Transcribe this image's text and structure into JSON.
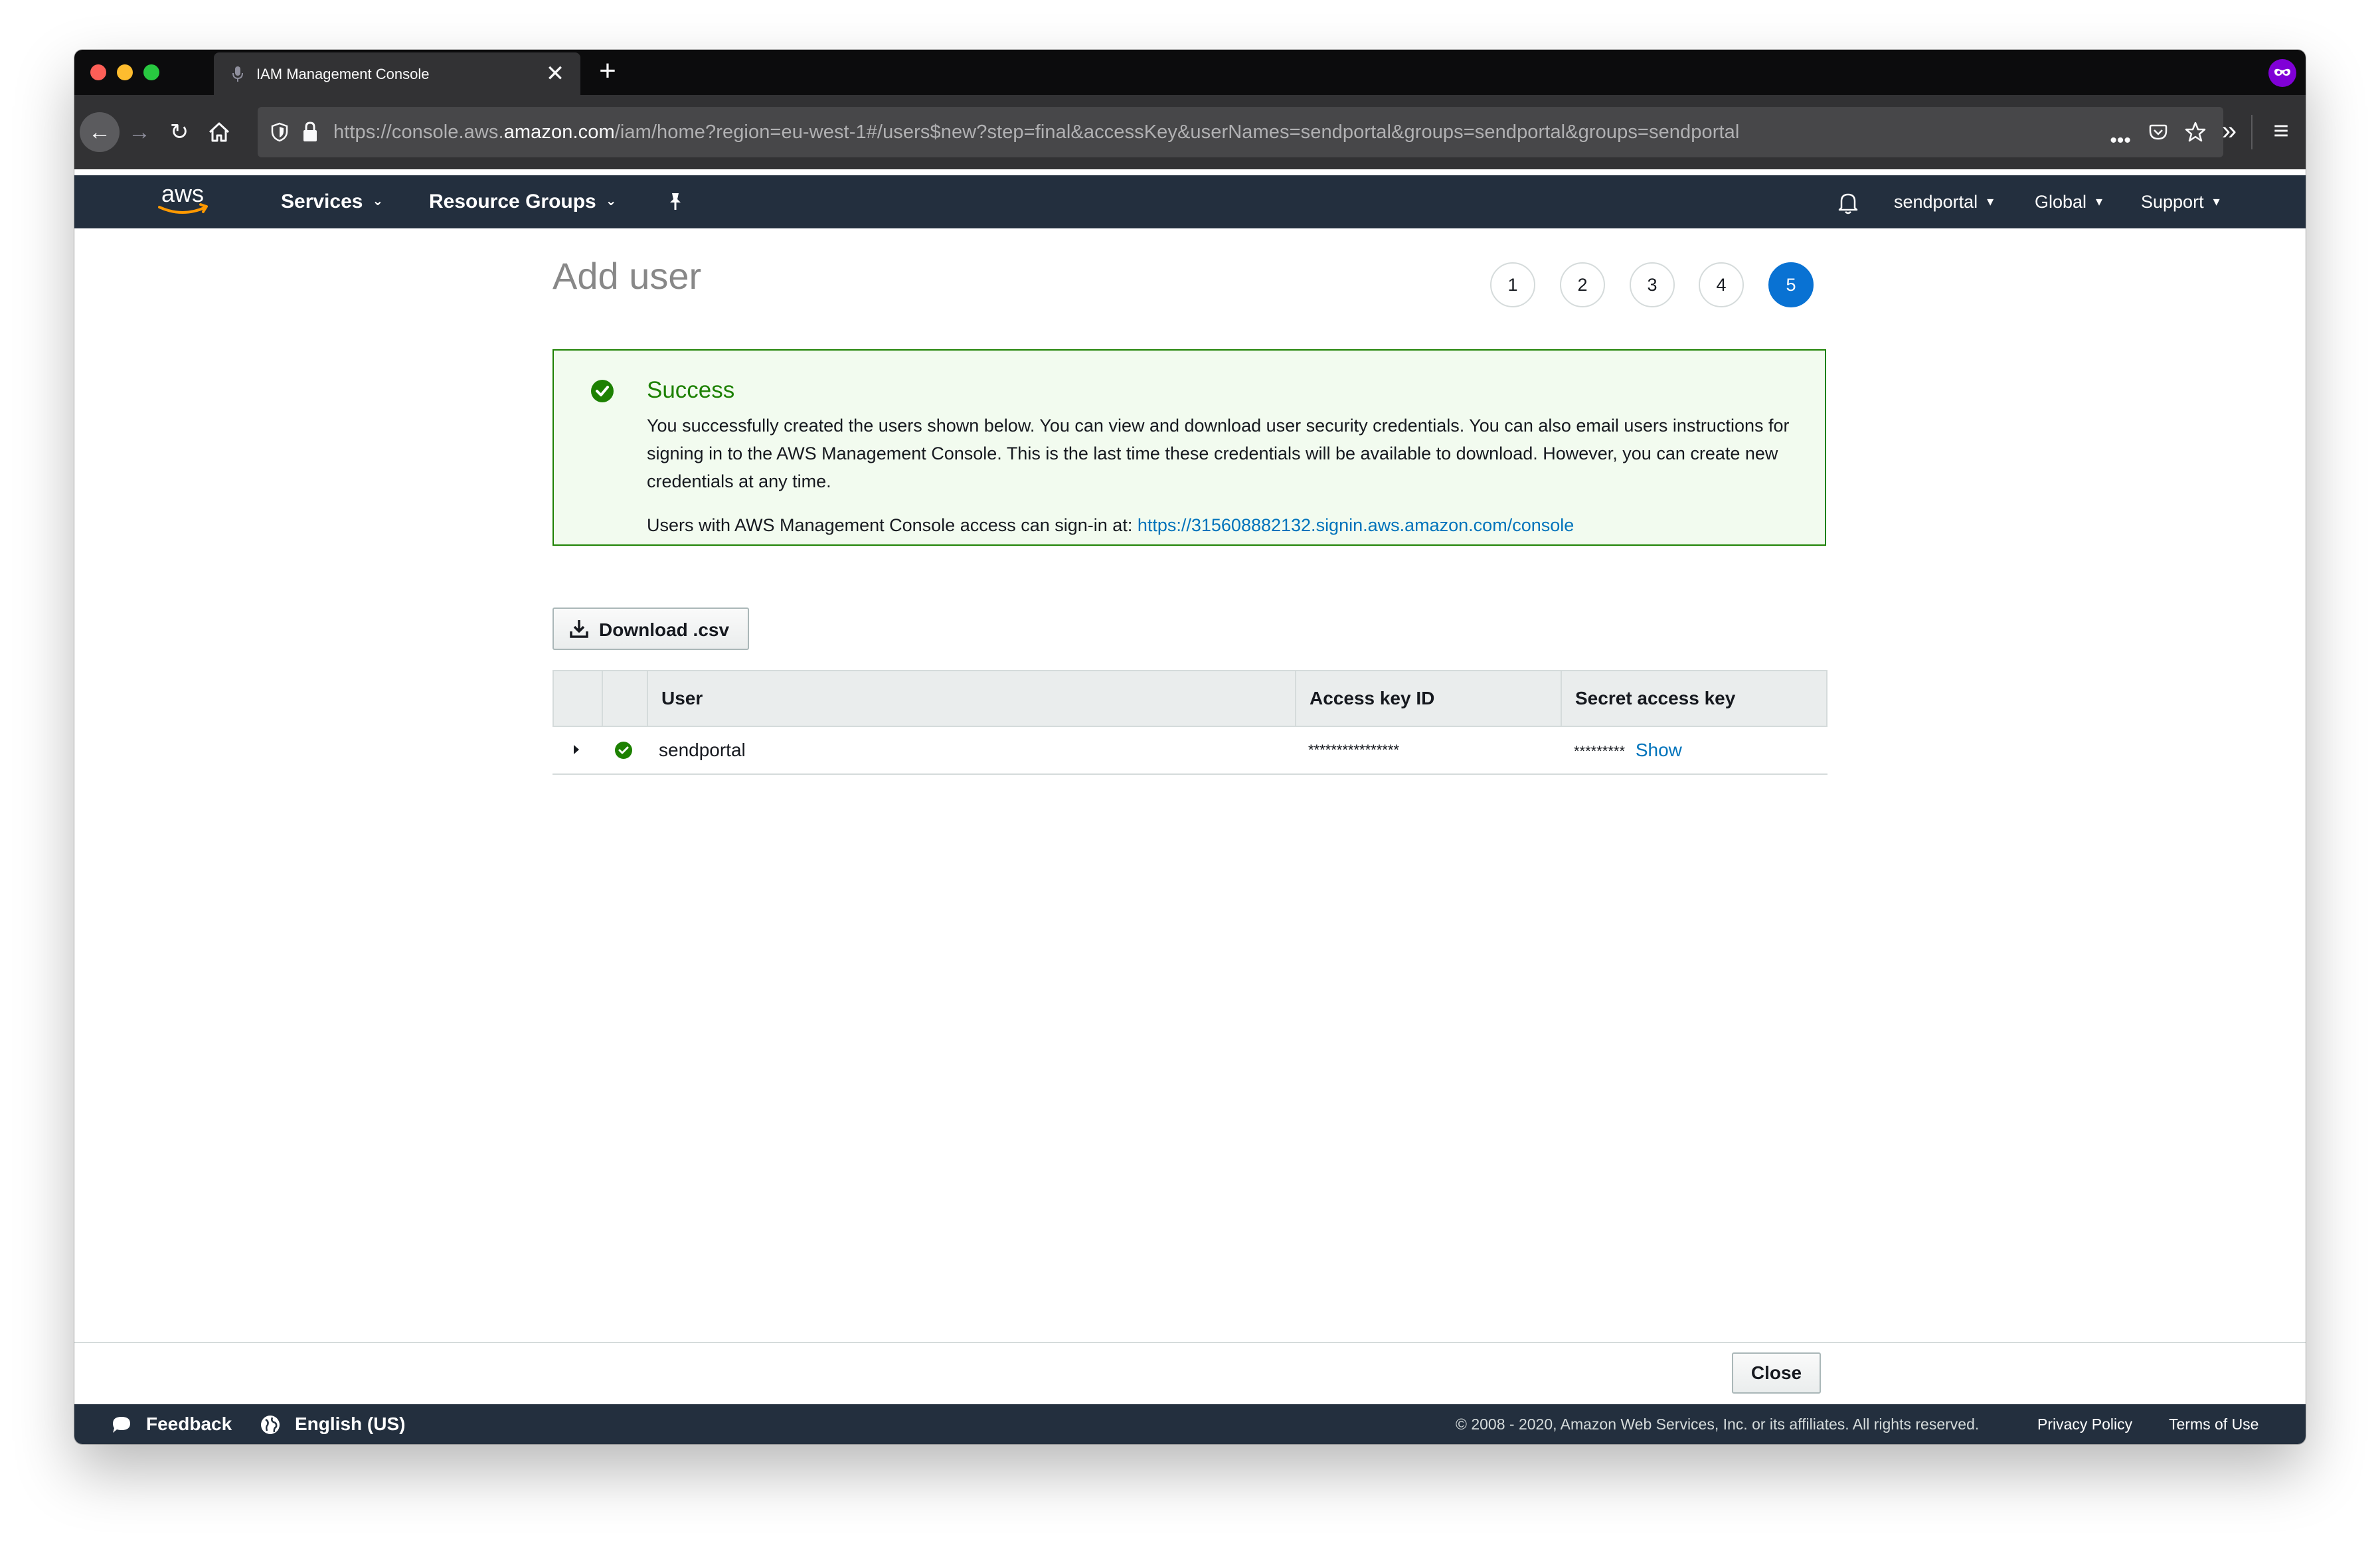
{
  "browser": {
    "tab_title": "IAM Management Console",
    "tab_close": "✕",
    "new_tab": "+",
    "url_prefix": "https://console.aws.",
    "url_domain": "amazon.com",
    "url_path": "/iam/home?region=eu-west-1#/users$new?step=final&accessKey&userNames=sendportal&groups=sendportal&groups=sendportal",
    "url_more": "•••",
    "back": "←",
    "forward": "→",
    "reload": "↻",
    "overflow": "»",
    "menu": "≡"
  },
  "aws_header": {
    "services": "Services",
    "resource_groups": "Resource Groups",
    "account": "sendportal",
    "region": "Global",
    "support": "Support"
  },
  "page": {
    "title": "Add user",
    "steps": [
      "1",
      "2",
      "3",
      "4",
      "5"
    ],
    "active_step": 5
  },
  "alert": {
    "title": "Success",
    "body": "You successfully created the users shown below. You can view and download user security credentials. You can also email users instructions for signing in to the AWS Management Console. This is the last time these credentials will be available to download. However, you can create new credentials at any time.",
    "signin_prefix": "Users with AWS Management Console access can sign-in at: ",
    "signin_url": "https://315608882132.signin.aws.amazon.com/console",
    "status_color": "#1d8102"
  },
  "download_button": "Download .csv",
  "table": {
    "headers": [
      "User",
      "Access key ID",
      "Secret access key"
    ],
    "rows": [
      {
        "user": "sendportal",
        "access_key_id": "****************",
        "secret_access_key": "*********",
        "show_link": "Show"
      }
    ]
  },
  "close_button": "Close",
  "footer": {
    "feedback": "Feedback",
    "language": "English (US)",
    "copyright": "© 2008 - 2020, Amazon Web Services, Inc. or its affiliates. All rights reserved.",
    "privacy": "Privacy Policy",
    "terms": "Terms of Use"
  },
  "colors": {
    "aws_nav": "#232f3e",
    "accent_blue": "#0972d3",
    "link_blue": "#0073bb",
    "success_green": "#1d8102"
  }
}
